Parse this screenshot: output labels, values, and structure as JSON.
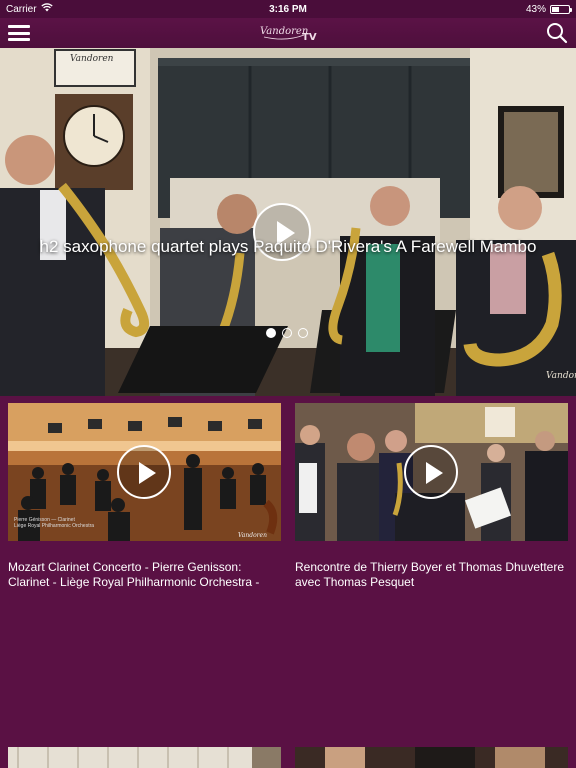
{
  "status_bar": {
    "carrier": "Carrier",
    "time": "3:16 PM",
    "battery": "43%",
    "battery_level": 0.43
  },
  "nav": {
    "logo_text": "Vandoren",
    "logo_mark": "TV",
    "menu_icon": "hamburger-menu-icon",
    "search_icon": "search-icon"
  },
  "hero": {
    "title": "h2 saxophone quartet plays Paquito D'Rivera's A Farewell Mambo",
    "watermark": "Vandoren",
    "wall_sign": "Vandoren",
    "slide_count": 3,
    "active_slide": 1
  },
  "cards": [
    {
      "title": "Mozart Clarinet Concerto - Pierre Genisson: Clarinet - Liège Royal Philharmonic Orchestra -",
      "caption_line1": "Pierre Génisson — Clarinet",
      "caption_line2": "Liège Royal Philharmonic Orchestra",
      "watermark": "Vandoren"
    },
    {
      "title": "Rencontre de Thierry Boyer et Thomas Dhuvettere avec Thomas Pesquet"
    }
  ],
  "colors": {
    "background": "#5a1144",
    "nav": "#4e0f3c",
    "text": "#ffffff"
  }
}
